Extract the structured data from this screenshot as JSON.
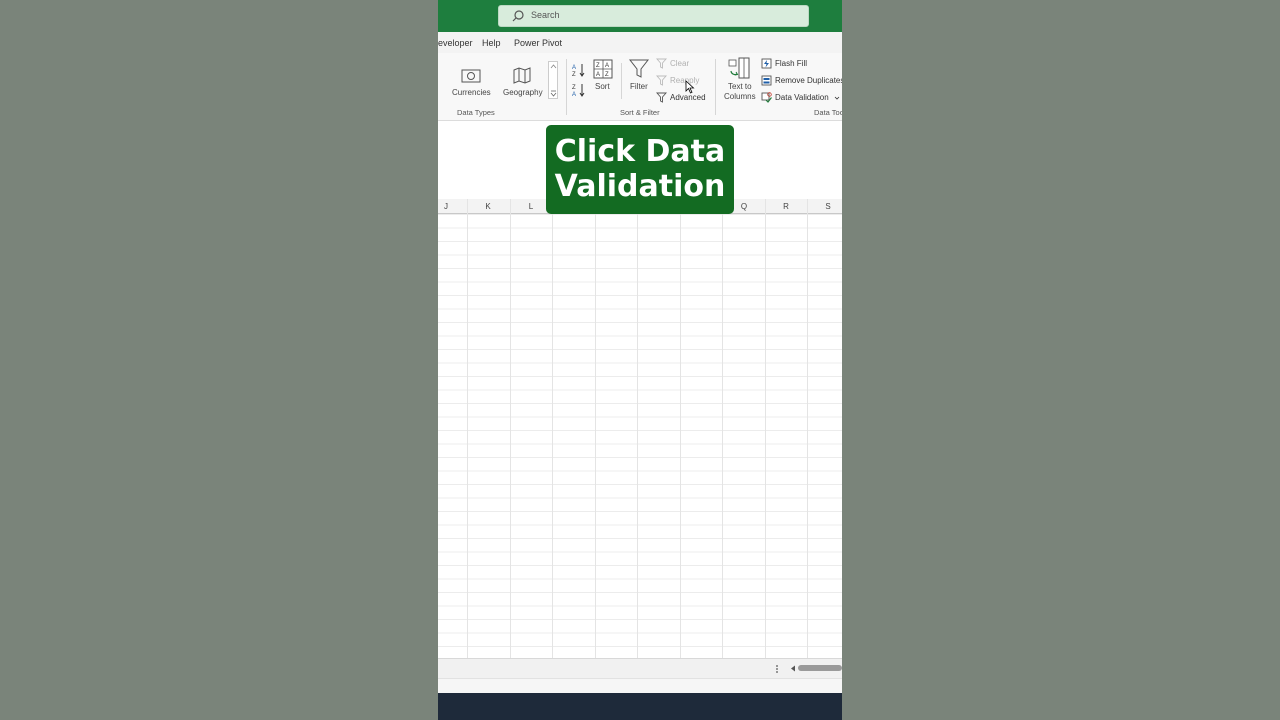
{
  "search": {
    "placeholder": "Search"
  },
  "menu": {
    "items": [
      "eveloper",
      "Help",
      "Power Pivot"
    ]
  },
  "ribbon": {
    "data_types": {
      "currencies": "Currencies",
      "geography": "Geography",
      "title": "Data Types"
    },
    "sort_filter": {
      "sort": "Sort",
      "filter": "Filter",
      "clear": "Clear",
      "reapply": "Reapply",
      "advanced": "Advanced",
      "title": "Sort & Filter"
    },
    "data_tools": {
      "text_to_columns_line1": "Text to",
      "text_to_columns_line2": "Columns",
      "flash_fill": "Flash Fill",
      "remove_duplicates": "Remove Duplicates",
      "data_validation": "Data Validation",
      "title": "Data Too"
    }
  },
  "overlay": {
    "line1": "Click Data",
    "line2": "Validation"
  },
  "columns": [
    "J",
    "K",
    "L",
    "Q",
    "R",
    "S"
  ],
  "colors": {
    "title_bar": "#1e7e3e",
    "overlay": "#136b22",
    "background": "#7a847a"
  }
}
